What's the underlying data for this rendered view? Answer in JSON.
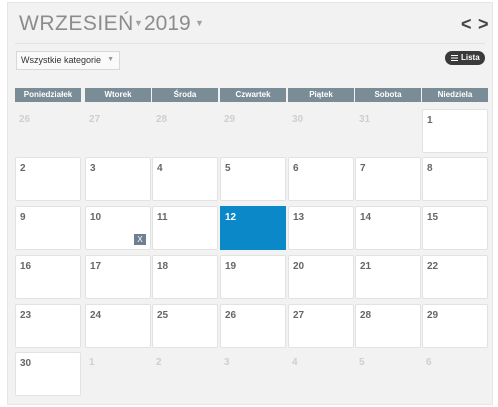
{
  "header": {
    "month": "WRZESIEŃ",
    "year": "2019",
    "prev": "<",
    "next": ">"
  },
  "filter": {
    "category": "Wszystkie kategorie"
  },
  "view_button": {
    "label": "Lista"
  },
  "weekdays": [
    "Poniedziałek",
    "Wtorek",
    "Środa",
    "Czwartek",
    "Piątek",
    "Sobota",
    "Niedziela"
  ],
  "weeks": [
    [
      {
        "d": "26",
        "m": "other"
      },
      {
        "d": "27",
        "m": "other"
      },
      {
        "d": "28",
        "m": "other"
      },
      {
        "d": "29",
        "m": "other"
      },
      {
        "d": "30",
        "m": "other"
      },
      {
        "d": "31",
        "m": "other"
      },
      {
        "d": "1",
        "m": "cur"
      }
    ],
    [
      {
        "d": "2",
        "m": "cur"
      },
      {
        "d": "3",
        "m": "cur"
      },
      {
        "d": "4",
        "m": "cur"
      },
      {
        "d": "5",
        "m": "cur"
      },
      {
        "d": "6",
        "m": "cur"
      },
      {
        "d": "7",
        "m": "cur"
      },
      {
        "d": "8",
        "m": "cur"
      }
    ],
    [
      {
        "d": "9",
        "m": "cur"
      },
      {
        "d": "10",
        "m": "cur",
        "event": "X"
      },
      {
        "d": "11",
        "m": "cur"
      },
      {
        "d": "12",
        "m": "today"
      },
      {
        "d": "13",
        "m": "cur"
      },
      {
        "d": "14",
        "m": "cur"
      },
      {
        "d": "15",
        "m": "cur"
      }
    ],
    [
      {
        "d": "16",
        "m": "cur"
      },
      {
        "d": "17",
        "m": "cur"
      },
      {
        "d": "18",
        "m": "cur"
      },
      {
        "d": "19",
        "m": "cur"
      },
      {
        "d": "20",
        "m": "cur"
      },
      {
        "d": "21",
        "m": "cur"
      },
      {
        "d": "22",
        "m": "cur"
      }
    ],
    [
      {
        "d": "23",
        "m": "cur"
      },
      {
        "d": "24",
        "m": "cur"
      },
      {
        "d": "25",
        "m": "cur"
      },
      {
        "d": "26",
        "m": "cur"
      },
      {
        "d": "27",
        "m": "cur"
      },
      {
        "d": "28",
        "m": "cur"
      },
      {
        "d": "29",
        "m": "cur"
      }
    ],
    [
      {
        "d": "30",
        "m": "cur"
      },
      {
        "d": "1",
        "m": "other"
      },
      {
        "d": "2",
        "m": "other"
      },
      {
        "d": "3",
        "m": "other"
      },
      {
        "d": "4",
        "m": "other"
      },
      {
        "d": "5",
        "m": "other"
      },
      {
        "d": "6",
        "m": "other"
      }
    ]
  ],
  "colors": {
    "today": "#0b88c8",
    "weekday_header": "#7a8c96",
    "event_badge": "#6f8090"
  }
}
